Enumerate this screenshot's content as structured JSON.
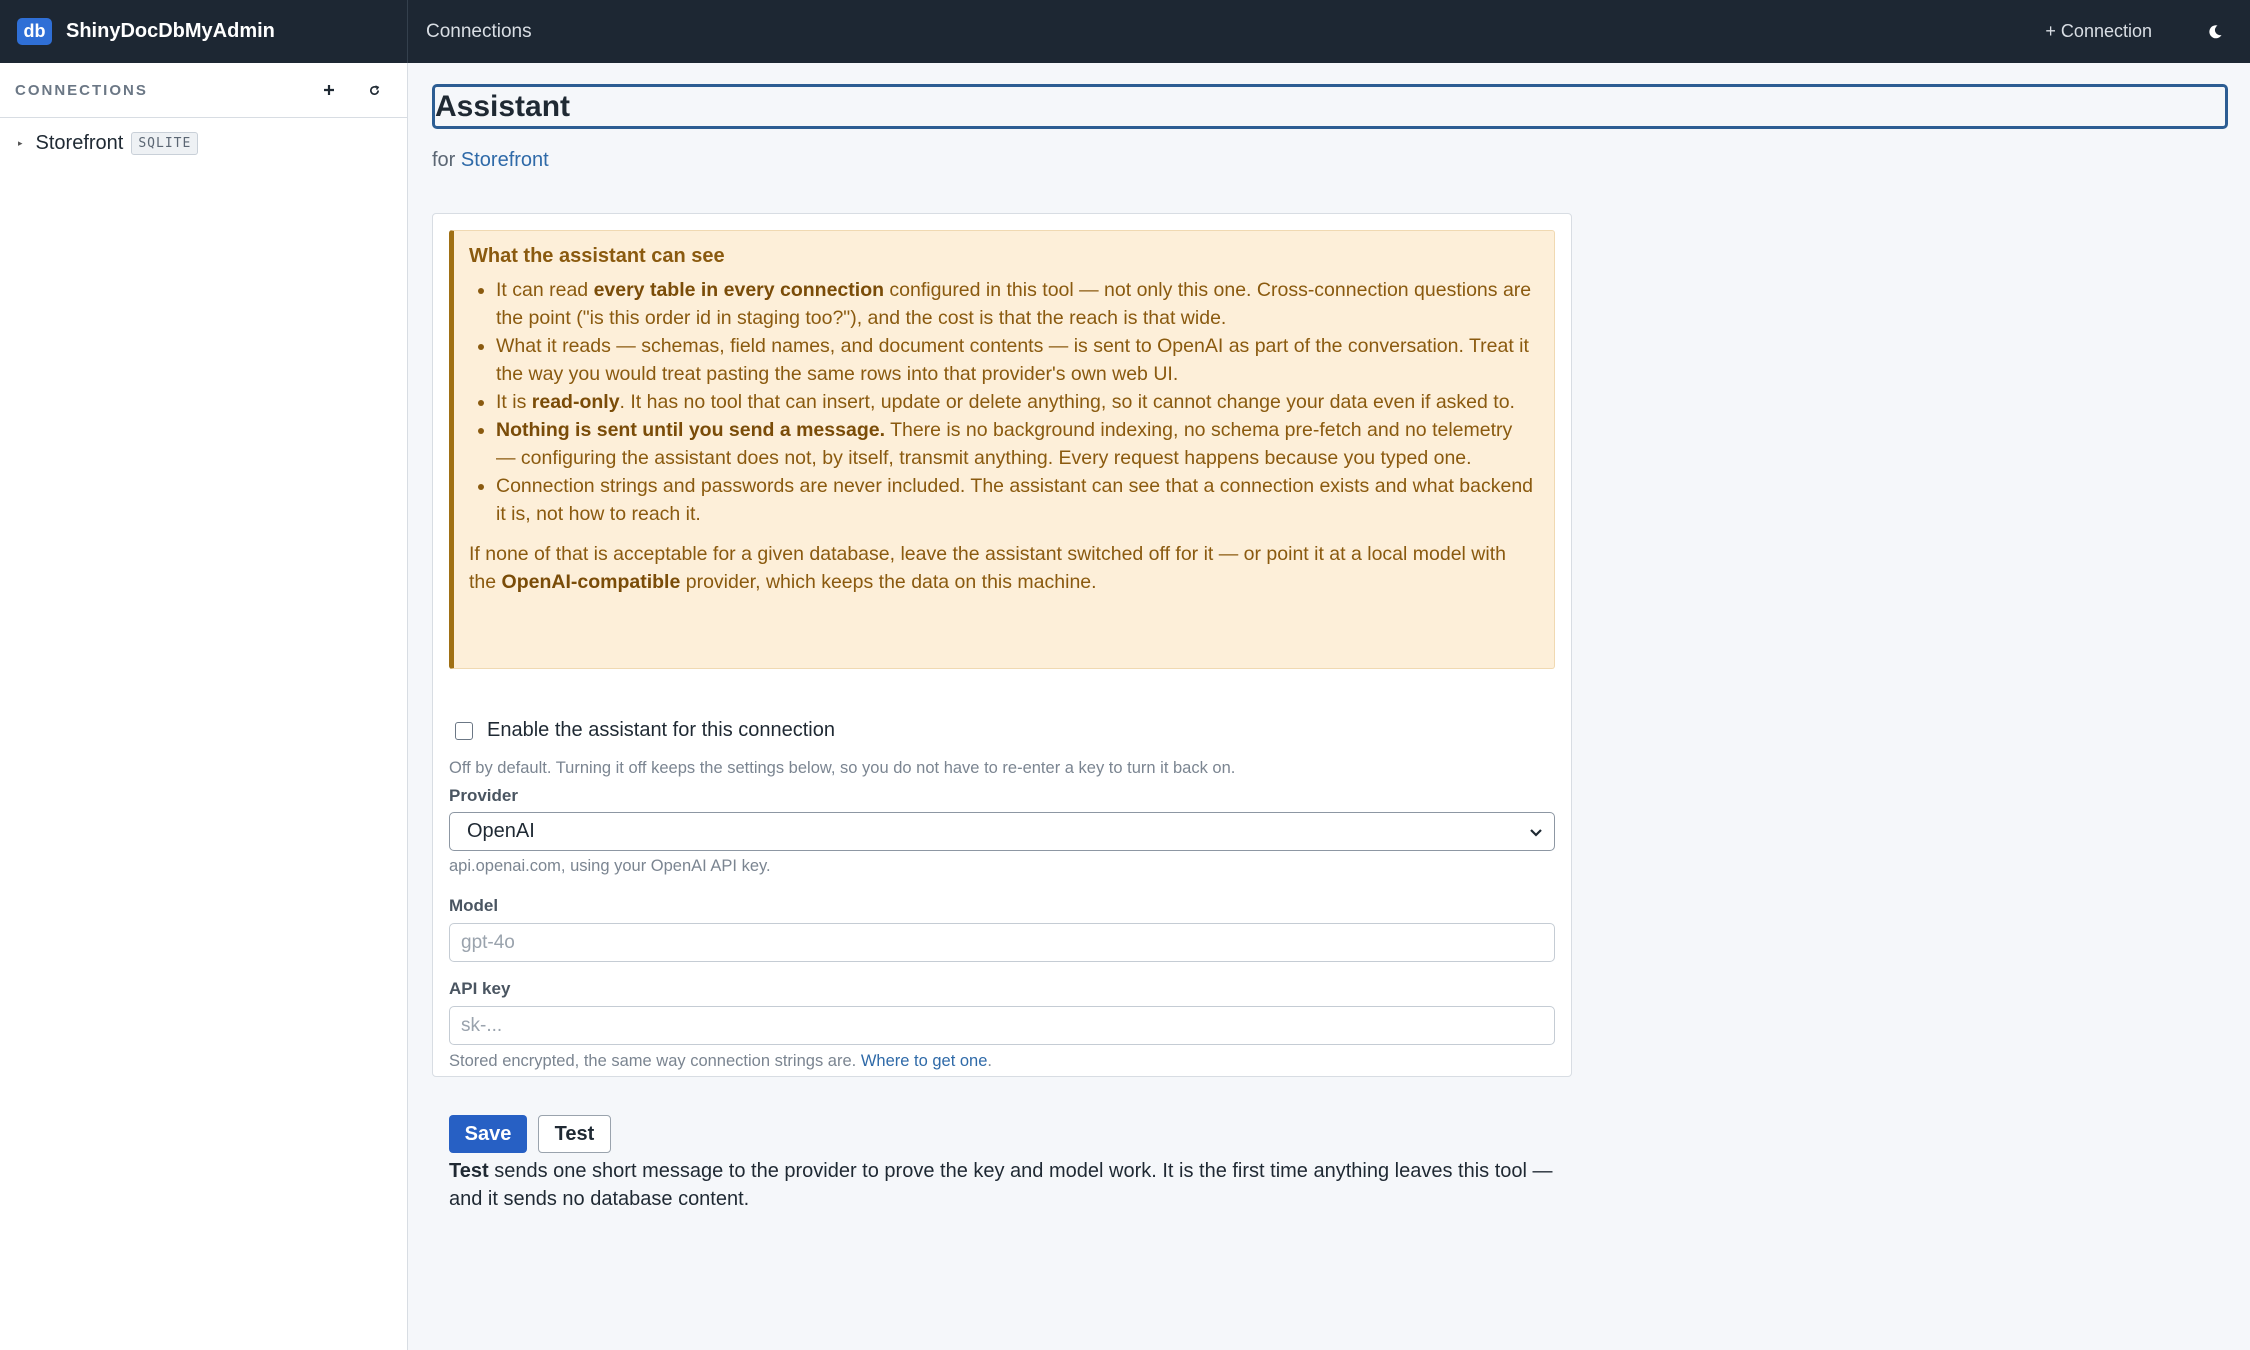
{
  "app": {
    "logo_text": "db",
    "name": "ShinyDocDbMyAdmin"
  },
  "header": {
    "breadcrumb": "Connections",
    "new_connection": "+ Connection",
    "theme_icon": "moon-icon"
  },
  "sidebar": {
    "title": "CONNECTIONS",
    "add_icon": "plus-icon",
    "refresh_icon": "refresh-icon",
    "items": [
      {
        "label": "Storefront",
        "badge": "SQLITE"
      }
    ]
  },
  "page": {
    "title": "Assistant",
    "subtitle_prefix": "for",
    "subtitle_link": "Storefront"
  },
  "warning": {
    "heading": "What the assistant can see",
    "b1_pre": "It can read ",
    "b1_bold": "every table in every connection",
    "b1_post": " configured in this tool — not only this one. Cross-connection questions are the point (\"is this order id in staging too?\"), and the cost is that the reach is that wide.",
    "b2": "What it reads — schemas, field names, and document contents — is sent to OpenAI as part of the conversation. Treat it the way you would treat pasting the same rows into that provider's own web UI.",
    "b3_pre": "It is ",
    "b3_bold": "read-only",
    "b3_post": ". It has no tool that can insert, update or delete anything, so it cannot change your data even if asked to.",
    "b4_bold": "Nothing is sent until you send a message.",
    "b4_post": " There is no background indexing, no schema pre-fetch and no telemetry — configuring the assistant does not, by itself, transmit anything. Every request happens because you typed one.",
    "b5": "Connection strings and passwords are never included. The assistant can see that a connection exists and what backend it is, not how to reach it.",
    "footer_pre": "If none of that is acceptable for a given database, leave the assistant switched off for it — or point it at a local model with the ",
    "footer_bold": "OpenAI-compatible",
    "footer_post": " provider, which keeps the data on this machine."
  },
  "form": {
    "enable_label": "Enable the assistant for this connection",
    "enable_checked": false,
    "enable_help": "Off by default. Turning it off keeps the settings below, so you do not have to re-enter a key to turn it back on.",
    "provider_label": "Provider",
    "provider_value": "OpenAI",
    "provider_help": "api.openai.com, using your OpenAI API key.",
    "model_label": "Model",
    "model_placeholder": "gpt-4o",
    "apikey_label": "API key",
    "apikey_placeholder": "sk-...",
    "apikey_help_pre": "Stored encrypted, the same way connection strings are. ",
    "apikey_help_link": "Where to get one",
    "apikey_help_post": ".",
    "save_label": "Save",
    "test_label": "Test",
    "test_note_bold": "Test",
    "test_note": " sends one short message to the provider to prove the key and model work. It is the first time anything leaves this tool — and it sends no database content."
  },
  "colors": {
    "accent": "#2760c4",
    "topbar": "#1d2733",
    "warning_bg": "#fdefd9",
    "warning_text": "#8a5a0f"
  }
}
